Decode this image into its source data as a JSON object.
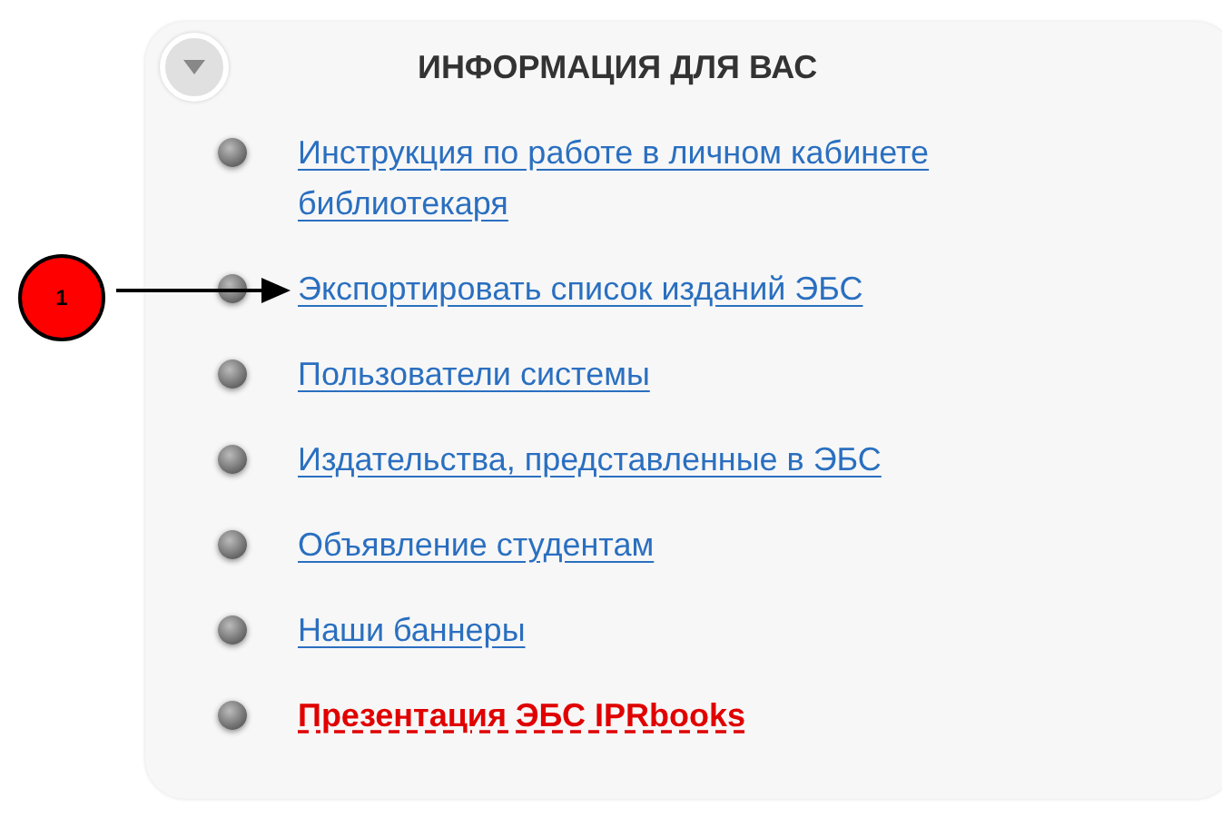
{
  "panel": {
    "title": "ИНФОРМАЦИЯ ДЛЯ ВАС",
    "expanded": true,
    "items": [
      {
        "kind": "link",
        "label": "Инструкция по работе в личном кабинете библиотекаря"
      },
      {
        "kind": "link",
        "label": "Экспортировать список изданий ЭБС"
      },
      {
        "kind": "link",
        "label": "Пользователи системы"
      },
      {
        "kind": "link",
        "label": "Издательства, представленные в ЭБС"
      },
      {
        "kind": "link",
        "label": "Объявление студентам"
      },
      {
        "kind": "link",
        "label": "Наши баннеры"
      },
      {
        "kind": "highlight",
        "label": "Презентация ЭБС IPRbooks"
      }
    ]
  },
  "callout": {
    "label": "1"
  }
}
